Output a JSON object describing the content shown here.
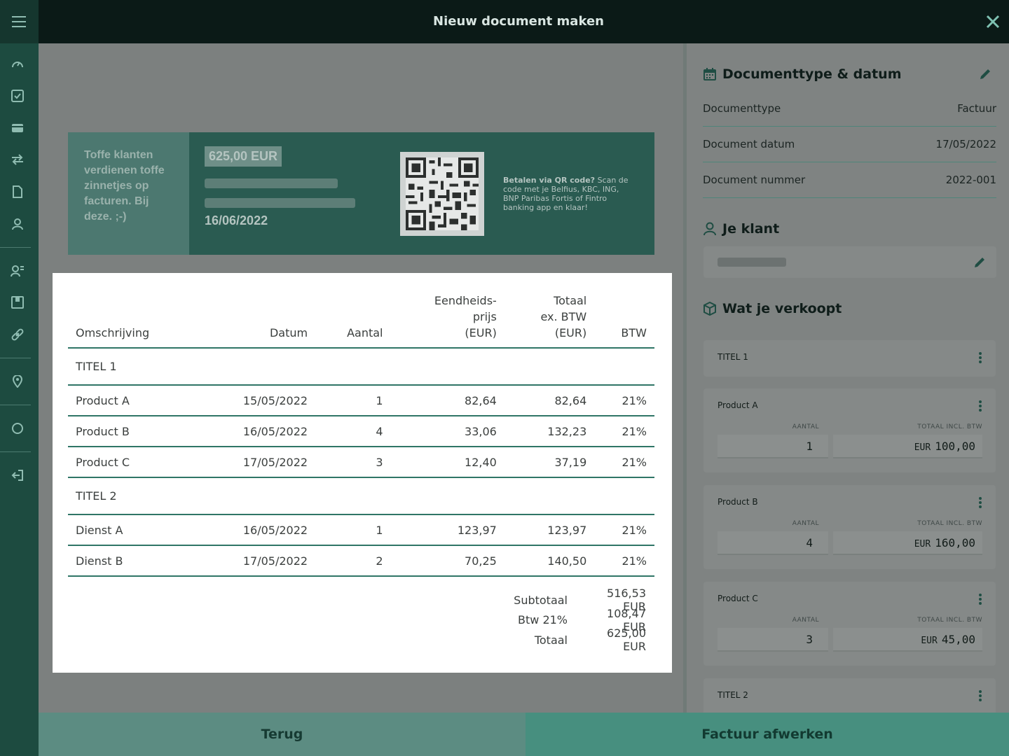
{
  "header": {
    "title": "Nieuw document maken"
  },
  "sidebar": {
    "icons": [
      "menu-icon",
      "dashboard-icon",
      "tasks-icon",
      "card-icon",
      "transfer-icon",
      "document-icon",
      "user-icon",
      "contacts-icon",
      "products-icon",
      "link-icon",
      "location-icon",
      "circle-icon",
      "logout-icon"
    ]
  },
  "preview": {
    "tagline": "Toffe klanten verdienen toffe zinnetjes op facturen. Bij deze. ;-)",
    "amount": "625,00 EUR",
    "due_date": "16/06/2022",
    "qr_text_bold": "Betalen via QR code?",
    "qr_text": "Scan de code met je Belfius, KBC, ING, BNP Paribas Fortis of Fintro banking app en klaar!"
  },
  "table": {
    "headers": {
      "description": "Omschrijving",
      "date": "Datum",
      "qty": "Aantal",
      "unit_price_1": "Eendheids-",
      "unit_price_2": "prijs",
      "unit_price_3": "(EUR)",
      "total_1": "Totaal",
      "total_2": "ex. BTW",
      "total_3": "(EUR)",
      "vat": "BTW"
    },
    "groups": [
      {
        "title": "TITEL 1",
        "rows": [
          {
            "name": "Product A",
            "date": "15/05/2022",
            "qty": "1",
            "unit": "82,64",
            "total": "82,64",
            "vat": "21%"
          },
          {
            "name": "Product B",
            "date": "16/05/2022",
            "qty": "4",
            "unit": "33,06",
            "total": "132,23",
            "vat": "21%"
          },
          {
            "name": "Product C",
            "date": "17/05/2022",
            "qty": "3",
            "unit": "12,40",
            "total": "37,19",
            "vat": "21%"
          }
        ]
      },
      {
        "title": "TITEL 2",
        "rows": [
          {
            "name": "Dienst A",
            "date": "16/05/2022",
            "qty": "1",
            "unit": "123,97",
            "total": "123,97",
            "vat": "21%"
          },
          {
            "name": "Dienst B",
            "date": "17/05/2022",
            "qty": "2",
            "unit": "70,25",
            "total": "140,50",
            "vat": "21%"
          }
        ]
      }
    ],
    "totals": {
      "subtotal_label": "Subtotaal",
      "subtotal": "516,53 EUR",
      "vat_label": "Btw 21%",
      "vat": "108,47 EUR",
      "total_label": "Totaal",
      "total": "625,00 EUR"
    }
  },
  "panel": {
    "doc_section_title": "Documenttype & datum",
    "doc_type_label": "Documenttype",
    "doc_type": "Factuur",
    "doc_date_label": "Document datum",
    "doc_date": "17/05/2022",
    "doc_number_label": "Document nummer",
    "doc_number": "2022-001",
    "client_section_title": "Je klant",
    "sell_section_title": "Wat je verkoopt",
    "qty_label": "AANTAL",
    "total_label": "TOTAAL INCL. BTW",
    "currency": "EUR",
    "cards": [
      {
        "name": "TITEL 1"
      },
      {
        "name": "Product A",
        "qty": "1",
        "total": "100,00"
      },
      {
        "name": "Product B",
        "qty": "4",
        "total": "160,00"
      },
      {
        "name": "Product C",
        "qty": "3",
        "total": "45,00"
      },
      {
        "name": "TITEL 2"
      }
    ]
  },
  "footer": {
    "back_label": "Terug",
    "finish_label": "Factuur afwerken"
  },
  "colors": {
    "sidebar": "#1d4b40",
    "header": "#0b1a17",
    "accent": "#2f7566",
    "finish_button": "#478f7f"
  }
}
